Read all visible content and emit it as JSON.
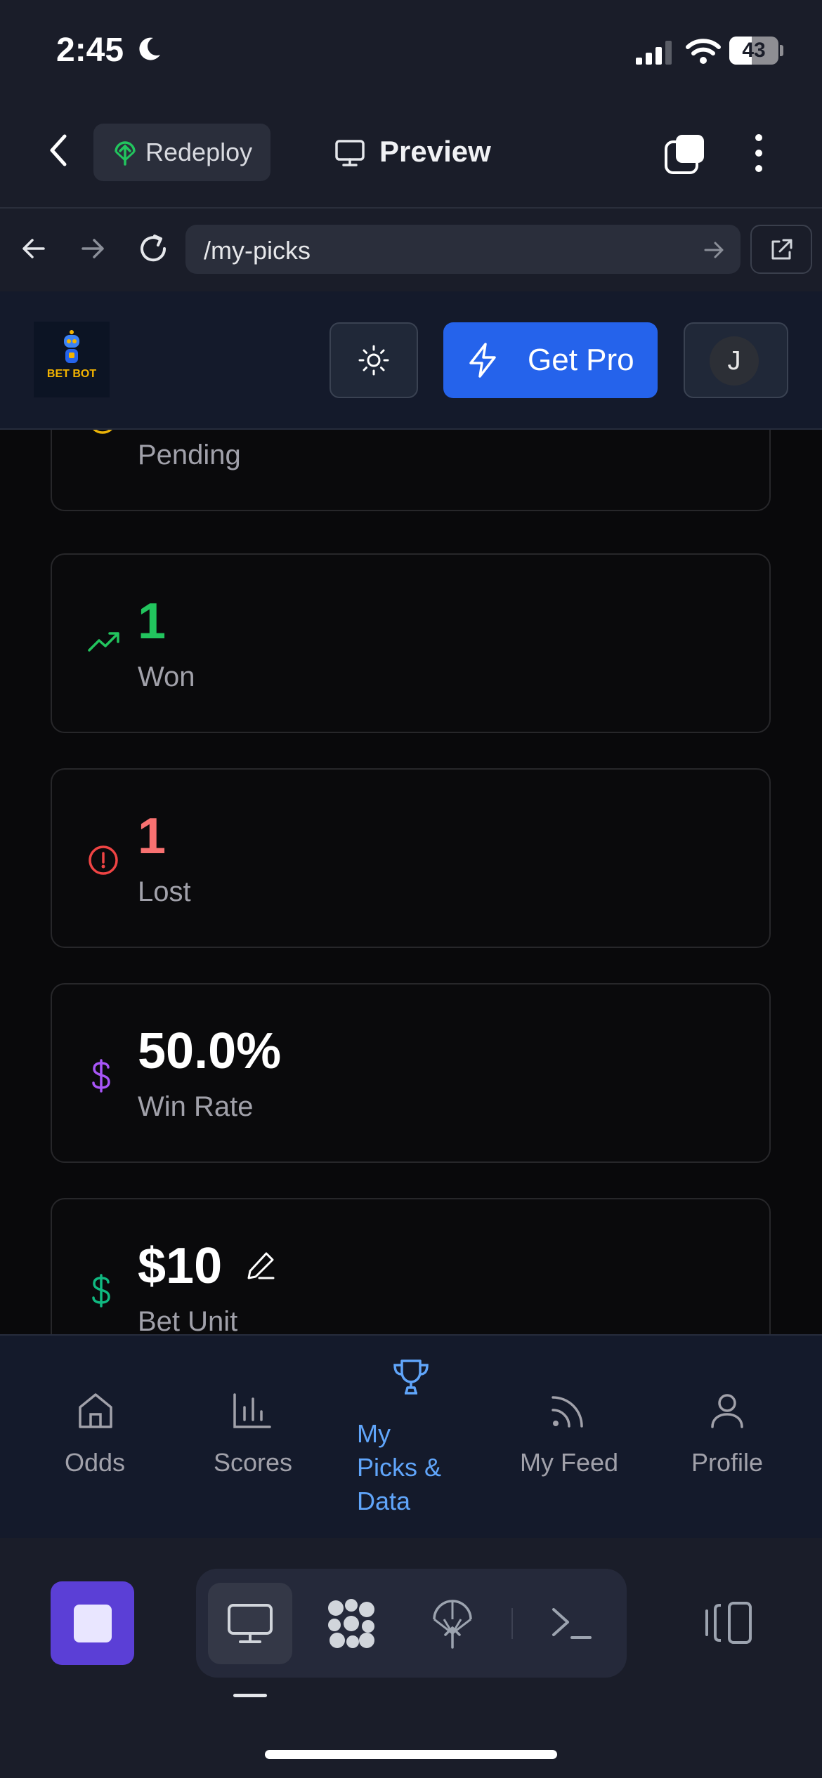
{
  "status_bar": {
    "time": "2:45",
    "battery": "43"
  },
  "app_bar": {
    "redeploy_label": "Redeploy",
    "preview_label": "Preview"
  },
  "browser": {
    "url": "/my-picks"
  },
  "site_header": {
    "logo_text": "BET BOT",
    "pro_label": "Get Pro",
    "avatar_initial": "J"
  },
  "stats": {
    "pending": {
      "label": "Pending",
      "color": "#eab308"
    },
    "won": {
      "value": "1",
      "label": "Won",
      "color": "#22c55e"
    },
    "lost": {
      "value": "1",
      "label": "Lost",
      "color": "#f87171"
    },
    "win_rate": {
      "value": "50.0%",
      "label": "Win Rate",
      "color": "#a855f7"
    },
    "bet_unit": {
      "value": "$10",
      "label": "Bet Unit",
      "color": "#10b981"
    }
  },
  "tabs": [
    {
      "label": "Odds",
      "icon": "home-icon"
    },
    {
      "label": "Scores",
      "icon": "bar-chart-icon"
    },
    {
      "label_lines": [
        "My",
        "Picks &",
        "Data"
      ],
      "icon": "trophy-icon",
      "active": true
    },
    {
      "label": "My Feed",
      "icon": "rss-icon"
    },
    {
      "label": "Profile",
      "icon": "user-icon"
    }
  ],
  "colors": {
    "accent": "#2563eb",
    "active_tab": "#60a5fa"
  }
}
